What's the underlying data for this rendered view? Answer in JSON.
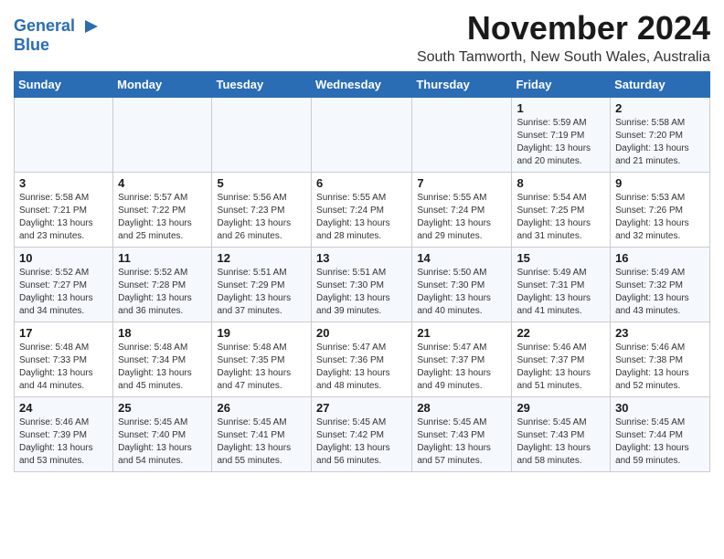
{
  "logo": {
    "line1": "General",
    "line2": "Blue"
  },
  "title": "November 2024",
  "subtitle": "South Tamworth, New South Wales, Australia",
  "weekdays": [
    "Sunday",
    "Monday",
    "Tuesday",
    "Wednesday",
    "Thursday",
    "Friday",
    "Saturday"
  ],
  "weeks": [
    [
      {
        "day": "",
        "detail": ""
      },
      {
        "day": "",
        "detail": ""
      },
      {
        "day": "",
        "detail": ""
      },
      {
        "day": "",
        "detail": ""
      },
      {
        "day": "",
        "detail": ""
      },
      {
        "day": "1",
        "detail": "Sunrise: 5:59 AM\nSunset: 7:19 PM\nDaylight: 13 hours\nand 20 minutes."
      },
      {
        "day": "2",
        "detail": "Sunrise: 5:58 AM\nSunset: 7:20 PM\nDaylight: 13 hours\nand 21 minutes."
      }
    ],
    [
      {
        "day": "3",
        "detail": "Sunrise: 5:58 AM\nSunset: 7:21 PM\nDaylight: 13 hours\nand 23 minutes."
      },
      {
        "day": "4",
        "detail": "Sunrise: 5:57 AM\nSunset: 7:22 PM\nDaylight: 13 hours\nand 25 minutes."
      },
      {
        "day": "5",
        "detail": "Sunrise: 5:56 AM\nSunset: 7:23 PM\nDaylight: 13 hours\nand 26 minutes."
      },
      {
        "day": "6",
        "detail": "Sunrise: 5:55 AM\nSunset: 7:24 PM\nDaylight: 13 hours\nand 28 minutes."
      },
      {
        "day": "7",
        "detail": "Sunrise: 5:55 AM\nSunset: 7:24 PM\nDaylight: 13 hours\nand 29 minutes."
      },
      {
        "day": "8",
        "detail": "Sunrise: 5:54 AM\nSunset: 7:25 PM\nDaylight: 13 hours\nand 31 minutes."
      },
      {
        "day": "9",
        "detail": "Sunrise: 5:53 AM\nSunset: 7:26 PM\nDaylight: 13 hours\nand 32 minutes."
      }
    ],
    [
      {
        "day": "10",
        "detail": "Sunrise: 5:52 AM\nSunset: 7:27 PM\nDaylight: 13 hours\nand 34 minutes."
      },
      {
        "day": "11",
        "detail": "Sunrise: 5:52 AM\nSunset: 7:28 PM\nDaylight: 13 hours\nand 36 minutes."
      },
      {
        "day": "12",
        "detail": "Sunrise: 5:51 AM\nSunset: 7:29 PM\nDaylight: 13 hours\nand 37 minutes."
      },
      {
        "day": "13",
        "detail": "Sunrise: 5:51 AM\nSunset: 7:30 PM\nDaylight: 13 hours\nand 39 minutes."
      },
      {
        "day": "14",
        "detail": "Sunrise: 5:50 AM\nSunset: 7:30 PM\nDaylight: 13 hours\nand 40 minutes."
      },
      {
        "day": "15",
        "detail": "Sunrise: 5:49 AM\nSunset: 7:31 PM\nDaylight: 13 hours\nand 41 minutes."
      },
      {
        "day": "16",
        "detail": "Sunrise: 5:49 AM\nSunset: 7:32 PM\nDaylight: 13 hours\nand 43 minutes."
      }
    ],
    [
      {
        "day": "17",
        "detail": "Sunrise: 5:48 AM\nSunset: 7:33 PM\nDaylight: 13 hours\nand 44 minutes."
      },
      {
        "day": "18",
        "detail": "Sunrise: 5:48 AM\nSunset: 7:34 PM\nDaylight: 13 hours\nand 45 minutes."
      },
      {
        "day": "19",
        "detail": "Sunrise: 5:48 AM\nSunset: 7:35 PM\nDaylight: 13 hours\nand 47 minutes."
      },
      {
        "day": "20",
        "detail": "Sunrise: 5:47 AM\nSunset: 7:36 PM\nDaylight: 13 hours\nand 48 minutes."
      },
      {
        "day": "21",
        "detail": "Sunrise: 5:47 AM\nSunset: 7:37 PM\nDaylight: 13 hours\nand 49 minutes."
      },
      {
        "day": "22",
        "detail": "Sunrise: 5:46 AM\nSunset: 7:37 PM\nDaylight: 13 hours\nand 51 minutes."
      },
      {
        "day": "23",
        "detail": "Sunrise: 5:46 AM\nSunset: 7:38 PM\nDaylight: 13 hours\nand 52 minutes."
      }
    ],
    [
      {
        "day": "24",
        "detail": "Sunrise: 5:46 AM\nSunset: 7:39 PM\nDaylight: 13 hours\nand 53 minutes."
      },
      {
        "day": "25",
        "detail": "Sunrise: 5:45 AM\nSunset: 7:40 PM\nDaylight: 13 hours\nand 54 minutes."
      },
      {
        "day": "26",
        "detail": "Sunrise: 5:45 AM\nSunset: 7:41 PM\nDaylight: 13 hours\nand 55 minutes."
      },
      {
        "day": "27",
        "detail": "Sunrise: 5:45 AM\nSunset: 7:42 PM\nDaylight: 13 hours\nand 56 minutes."
      },
      {
        "day": "28",
        "detail": "Sunrise: 5:45 AM\nSunset: 7:43 PM\nDaylight: 13 hours\nand 57 minutes."
      },
      {
        "day": "29",
        "detail": "Sunrise: 5:45 AM\nSunset: 7:43 PM\nDaylight: 13 hours\nand 58 minutes."
      },
      {
        "day": "30",
        "detail": "Sunrise: 5:45 AM\nSunset: 7:44 PM\nDaylight: 13 hours\nand 59 minutes."
      }
    ]
  ]
}
